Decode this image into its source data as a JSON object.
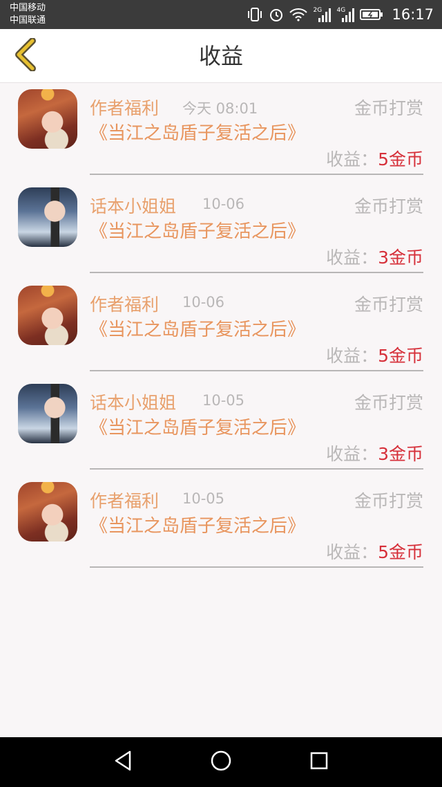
{
  "status_bar": {
    "carrier1": "中国移动",
    "carrier2": "中国联通",
    "net1": "2G",
    "net2": "4G",
    "time": "16:17"
  },
  "header": {
    "title": "收益",
    "back_icon": "chevron-left-icon",
    "accent_color": "#e7c030"
  },
  "items": [
    {
      "author": "作者福利",
      "date": "今天 08:01",
      "type": "金币打赏",
      "book": "《当江之岛盾子复活之后》",
      "earn_label": "收益：",
      "earn_value": "5金币",
      "avatar": "anime-girl"
    },
    {
      "author": "话本小姐姐",
      "date": "10-06",
      "type": "金币打赏",
      "book": "《当江之岛盾子复活之后》",
      "earn_label": "收益：",
      "earn_value": "3金币",
      "avatar": "lady-sunglasses"
    },
    {
      "author": "作者福利",
      "date": "10-06",
      "type": "金币打赏",
      "book": "《当江之岛盾子复活之后》",
      "earn_label": "收益：",
      "earn_value": "5金币",
      "avatar": "anime-girl"
    },
    {
      "author": "话本小姐姐",
      "date": "10-05",
      "type": "金币打赏",
      "book": "《当江之岛盾子复活之后》",
      "earn_label": "收益：",
      "earn_value": "3金币",
      "avatar": "lady-sunglasses"
    },
    {
      "author": "作者福利",
      "date": "10-05",
      "type": "金币打赏",
      "book": "《当江之岛盾子复活之后》",
      "earn_label": "收益：",
      "earn_value": "5金币",
      "avatar": "anime-girl"
    }
  ],
  "colors": {
    "author": "#e8a06c",
    "book": "#e8955e",
    "muted": "#b9b7b7",
    "earn_value": "#d6303a"
  },
  "nav": {
    "back_icon": "triangle-back-icon",
    "home_icon": "circle-home-icon",
    "recent_icon": "square-recent-icon"
  }
}
